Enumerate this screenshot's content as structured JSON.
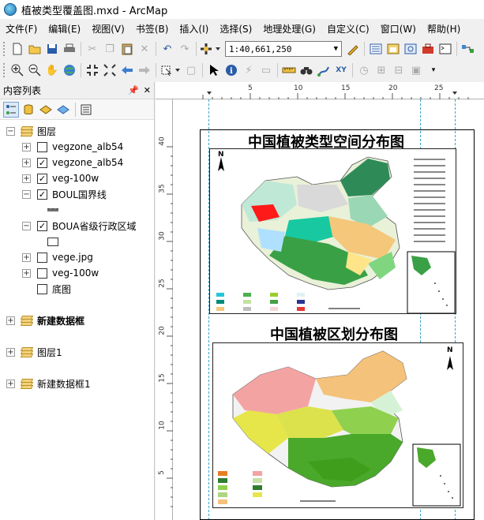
{
  "window": {
    "title": "植被类型覆盖图.mxd - ArcMap"
  },
  "menu": [
    "文件(F)",
    "编辑(E)",
    "视图(V)",
    "书签(B)",
    "插入(I)",
    "选择(S)",
    "地理处理(G)",
    "自定义(C)",
    "窗口(W)",
    "帮助(H)"
  ],
  "toolbar": {
    "scale_value": "1:40,661,250"
  },
  "toc": {
    "title": "内容列表",
    "root_frame": "图层",
    "layers": [
      {
        "name": "vegzone_alb54",
        "checked": ""
      },
      {
        "name": "vegzone_alb54",
        "checked": "✓"
      },
      {
        "name": "veg-100w",
        "checked": "✓"
      },
      {
        "name": "BOUL国界线",
        "checked": "✓"
      },
      {
        "name": "BOUA省级行政区域",
        "checked": "✓"
      },
      {
        "name": "vege.jpg",
        "checked": ""
      },
      {
        "name": "veg-100w",
        "checked": ""
      },
      {
        "name": "底图",
        "checked": ""
      }
    ],
    "frames": [
      "新建数据框",
      "图层1",
      "新建数据框1"
    ]
  },
  "layout": {
    "hruler_labels": [
      "5",
      "10",
      "15",
      "20",
      "25"
    ],
    "vruler_labels": [
      "40",
      "35",
      "30",
      "25",
      "20",
      "15",
      "10",
      "5"
    ],
    "map1_title": "中国植被类型空间分布图",
    "map2_title": "中国植被区划分布图",
    "north_label": "N"
  },
  "colors": {
    "map1_palette": [
      "#2e8b57",
      "#7fffd4",
      "#9acd32",
      "#f4c77a",
      "#dcdcdc",
      "#ff0000"
    ],
    "map2_palette": [
      "#f4a3a3",
      "#f4c27a",
      "#dce24b",
      "#8fd04f",
      "#3f9e1c",
      "#e6e64a"
    ]
  }
}
